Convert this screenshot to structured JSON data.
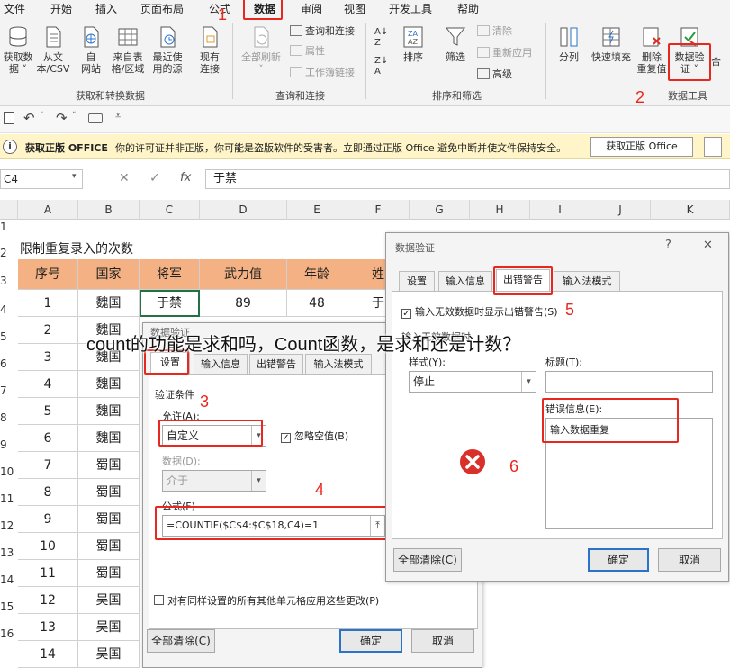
{
  "menubar": {
    "items": [
      "文件",
      "开始",
      "插入",
      "页面布局",
      "公式",
      "数据",
      "审阅",
      "视图",
      "开发工具",
      "帮助"
    ],
    "active": "数据"
  },
  "ribbon": {
    "get_transform": {
      "buttons": [
        "获取数据",
        "从文本/CSV",
        "自网站",
        "来自表格/区域",
        "最近使用的源",
        "现有连接"
      ],
      "button_lines": [
        [
          "获取数",
          "据 ˅"
        ],
        [
          "从文",
          "本/CSV"
        ],
        [
          "自",
          "网站"
        ],
        [
          "来自表",
          "格/区域"
        ],
        [
          "最近使",
          "用的源"
        ],
        [
          "现有",
          "连接"
        ]
      ],
      "label": "获取和转换数据"
    },
    "queries": {
      "refresh_all": "全部刷新",
      "items": [
        "查询和连接",
        "属性",
        "工作簿链接"
      ],
      "label": "查询和连接"
    },
    "sort_filter": {
      "sort_label": "排序",
      "filter_label": "筛选",
      "items": [
        "清除",
        "重新应用",
        "高级"
      ],
      "label": "排序和筛选"
    },
    "data_tools": {
      "buttons": [
        "分列",
        "快速填充",
        "删除重复值",
        "数据验证"
      ],
      "button_lines": [
        [
          "分列"
        ],
        [
          "快速填充"
        ],
        [
          "删除",
          "重复值"
        ],
        [
          "数据验",
          "证 ˅"
        ]
      ],
      "extra": "合",
      "label": "数据工具"
    }
  },
  "message_bar": {
    "title": "获取正版 OFFICE",
    "text": "你的许可证并非正版，你可能是盗版软件的受害者。立即通过正版 Office 避免中断并使文件保持安全。",
    "button": "获取正版 Office"
  },
  "formula_bar": {
    "name_box": "C4",
    "fx": "fx",
    "value": "于禁"
  },
  "columns": [
    "A",
    "B",
    "C",
    "D",
    "E",
    "F",
    "G",
    "H",
    "I",
    "J",
    "K"
  ],
  "sheet": {
    "title": "限制重复录入的次数",
    "headers": [
      "序号",
      "国家",
      "将军",
      "武力值",
      "年龄",
      "姓"
    ],
    "first_row": [
      "1",
      "魏国",
      "于禁",
      "89",
      "48",
      "于"
    ],
    "seq": [
      "1",
      "2",
      "3",
      "4",
      "5",
      "6",
      "7",
      "8",
      "9",
      "10",
      "11",
      "12",
      "13",
      "14"
    ],
    "countries": [
      "魏国",
      "魏国",
      "魏国",
      "魏国",
      "魏国",
      "魏国",
      "蜀国",
      "蜀国",
      "蜀国",
      "蜀国",
      "蜀国",
      "吴国",
      "吴国",
      "吴国"
    ],
    "row_numbers": [
      "1",
      "2",
      "3",
      "4",
      "5",
      "6",
      "7",
      "8",
      "9",
      "10",
      "11",
      "12",
      "13",
      "14",
      "15",
      "16"
    ]
  },
  "dialog_left": {
    "title": "数据验证",
    "tabs": [
      "设置",
      "输入信息",
      "出错警告",
      "输入法模式"
    ],
    "criteria_label": "验证条件",
    "allow_label": "允许(A):",
    "allow_value": "自定义",
    "ignore_blank": "忽略空值(B)",
    "data_label": "数据(D):",
    "data_value": "介于",
    "formula_label": "公式(F)",
    "formula_value": "=COUNTIF($C$4:$C$18,C4)=1",
    "apply_all": "对有同样设置的所有其他单元格应用这些更改(P)",
    "clear_all": "全部清除(C)",
    "ok": "确定",
    "cancel": "取消"
  },
  "dialog_right": {
    "title": "数据验证",
    "help": "?",
    "close": "✕",
    "tabs": [
      "设置",
      "输入信息",
      "出错警告",
      "输入法模式"
    ],
    "show_alert": "输入无效数据时显示出错警告(S)",
    "when_label": "输入无效数据时",
    "style_label": "样式(Y):",
    "style_value": "停止",
    "title_label": "标题(T):",
    "error_label": "错误信息(E):",
    "error_value": "输入数据重复",
    "clear_all": "全部清除(C)",
    "ok": "确定",
    "cancel": "取消"
  },
  "annotations": [
    "1",
    "2",
    "3",
    "4",
    "5",
    "6"
  ],
  "caption": "count的功能是求和吗，Count函数，是求和还是计数？",
  "colors": {
    "header_fill": "#f4b183",
    "annotation": "#e8281e",
    "message_bar": "#fff5c8",
    "stop_icon": "#d9302a"
  }
}
